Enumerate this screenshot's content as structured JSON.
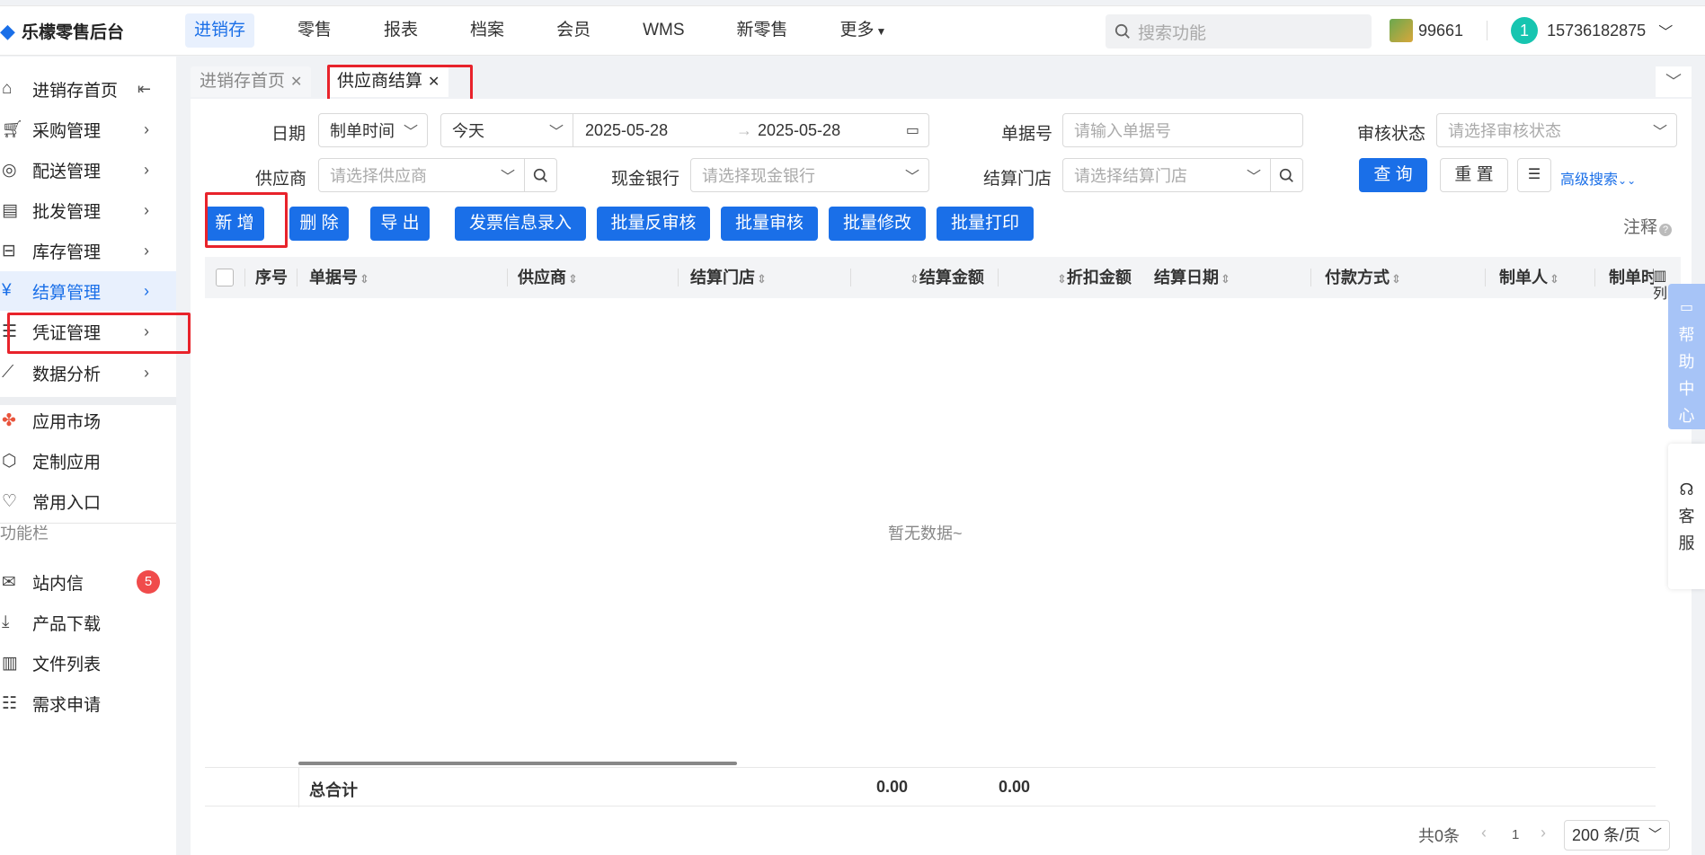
{
  "app": {
    "logo_text": "乐檬零售后台"
  },
  "topnav": {
    "items": [
      "进销存",
      "零售",
      "报表",
      "档案",
      "会员",
      "WMS",
      "新零售",
      "更多"
    ],
    "active": "进销存"
  },
  "search": {
    "placeholder": "搜索功能"
  },
  "user": {
    "shop_code": "99661",
    "avatar_letter": "1",
    "phone": "15736182875"
  },
  "sidebar": {
    "items": [
      {
        "label": "进销存首页",
        "icon": "home-icon"
      },
      {
        "label": "采购管理",
        "icon": "cart-icon"
      },
      {
        "label": "配送管理",
        "icon": "delivery-icon"
      },
      {
        "label": "批发管理",
        "icon": "wholesale-icon"
      },
      {
        "label": "库存管理",
        "icon": "inventory-icon"
      },
      {
        "label": "结算管理",
        "icon": "settlement-icon"
      },
      {
        "label": "凭证管理",
        "icon": "voucher-icon"
      },
      {
        "label": "数据分析",
        "icon": "chart-icon"
      }
    ],
    "apps": [
      {
        "label": "应用市场",
        "icon": "app-market-icon"
      },
      {
        "label": "定制应用",
        "icon": "cube-icon"
      },
      {
        "label": "常用入口",
        "icon": "heart-icon"
      }
    ],
    "func_label": "功能栏",
    "func_items": [
      {
        "label": "站内信",
        "icon": "mail-icon",
        "badge": "5"
      },
      {
        "label": "产品下载",
        "icon": "download-icon"
      },
      {
        "label": "文件列表",
        "icon": "file-list-icon"
      },
      {
        "label": "需求申请",
        "icon": "request-icon"
      }
    ]
  },
  "tabs": [
    {
      "label": "进销存首页",
      "active": false
    },
    {
      "label": "供应商结算",
      "active": true
    }
  ],
  "filters": {
    "date_label": "日期",
    "date_type": "制单时间",
    "date_range": "今天",
    "date_start": "2025-05-28",
    "date_sep": "→",
    "date_end": "2025-05-28",
    "doc_no_label": "单据号",
    "doc_no_placeholder": "请输入单据号",
    "audit_label": "审核状态",
    "audit_placeholder": "请选择审核状态",
    "supplier_label": "供应商",
    "supplier_placeholder": "请选择供应商",
    "bank_label": "现金银行",
    "bank_placeholder": "请选择现金银行",
    "store_label": "结算门店",
    "store_placeholder": "请选择结算门店",
    "query_btn": "查 询",
    "reset_btn": "重 置",
    "advanced_link": "高级搜索"
  },
  "actions": [
    "新 增",
    "删 除",
    "导 出",
    "发票信息录入",
    "批量反审核",
    "批量审核",
    "批量修改",
    "批量打印"
  ],
  "note_label": "注释",
  "table": {
    "columns": [
      "序号",
      "单据号",
      "供应商",
      "结算门店",
      "结算金额",
      "折扣金额",
      "结算日期",
      "付款方式",
      "制单人",
      "制单时"
    ],
    "empty_text": "暂无数据~",
    "total_label": "总合计",
    "total_amount": "0.00",
    "total_discount": "0.00",
    "col_toggle": "列"
  },
  "pagination": {
    "total": "共0条",
    "page": "1",
    "page_size": "200 条/页"
  },
  "floats": {
    "help": [
      "帮",
      "助",
      "中",
      "心"
    ],
    "service": [
      "客",
      "服"
    ]
  },
  "colors": {
    "primary": "#1a6fe8",
    "highlight": "#e8232b",
    "badge": "#f04b4b"
  }
}
